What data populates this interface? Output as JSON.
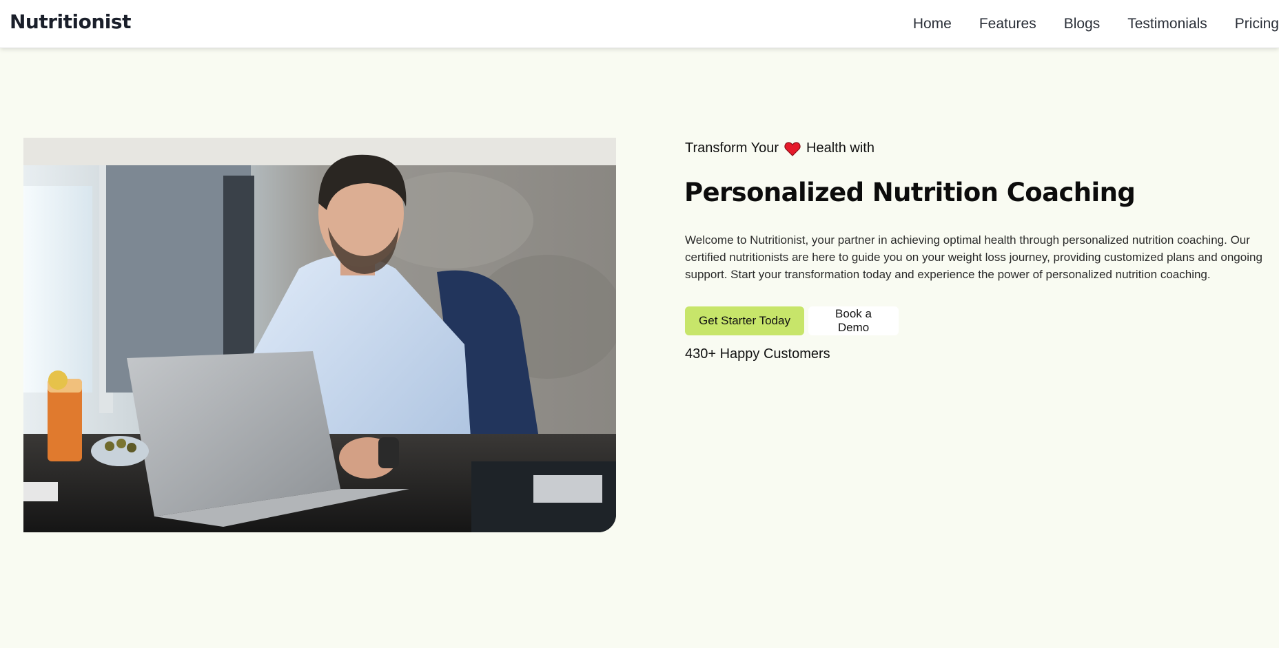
{
  "header": {
    "logo": "Nutritionist",
    "nav": [
      "Home",
      "Features",
      "Blogs",
      "Testimonials",
      "Pricing"
    ]
  },
  "hero": {
    "eyebrow_before": "Transform Your",
    "eyebrow_after": "Health with",
    "heart_color": "#e51a2a",
    "headline": "Personalized Nutrition Coaching",
    "description": "Welcome to Nutritionist, your partner in achieving optimal health through personalized nutrition coaching. Our certified nutritionists are here to guide you on your weight loss journey, providing customized plans and ongoing support. Start your transformation today and experience the power of personalized nutrition coaching.",
    "primary_button": "Get Starter Today",
    "secondary_button": "Book a Demo",
    "customers": "430+ Happy Customers"
  },
  "colors": {
    "page_bg": "#f9fbf2",
    "accent": "#c7e56a"
  }
}
